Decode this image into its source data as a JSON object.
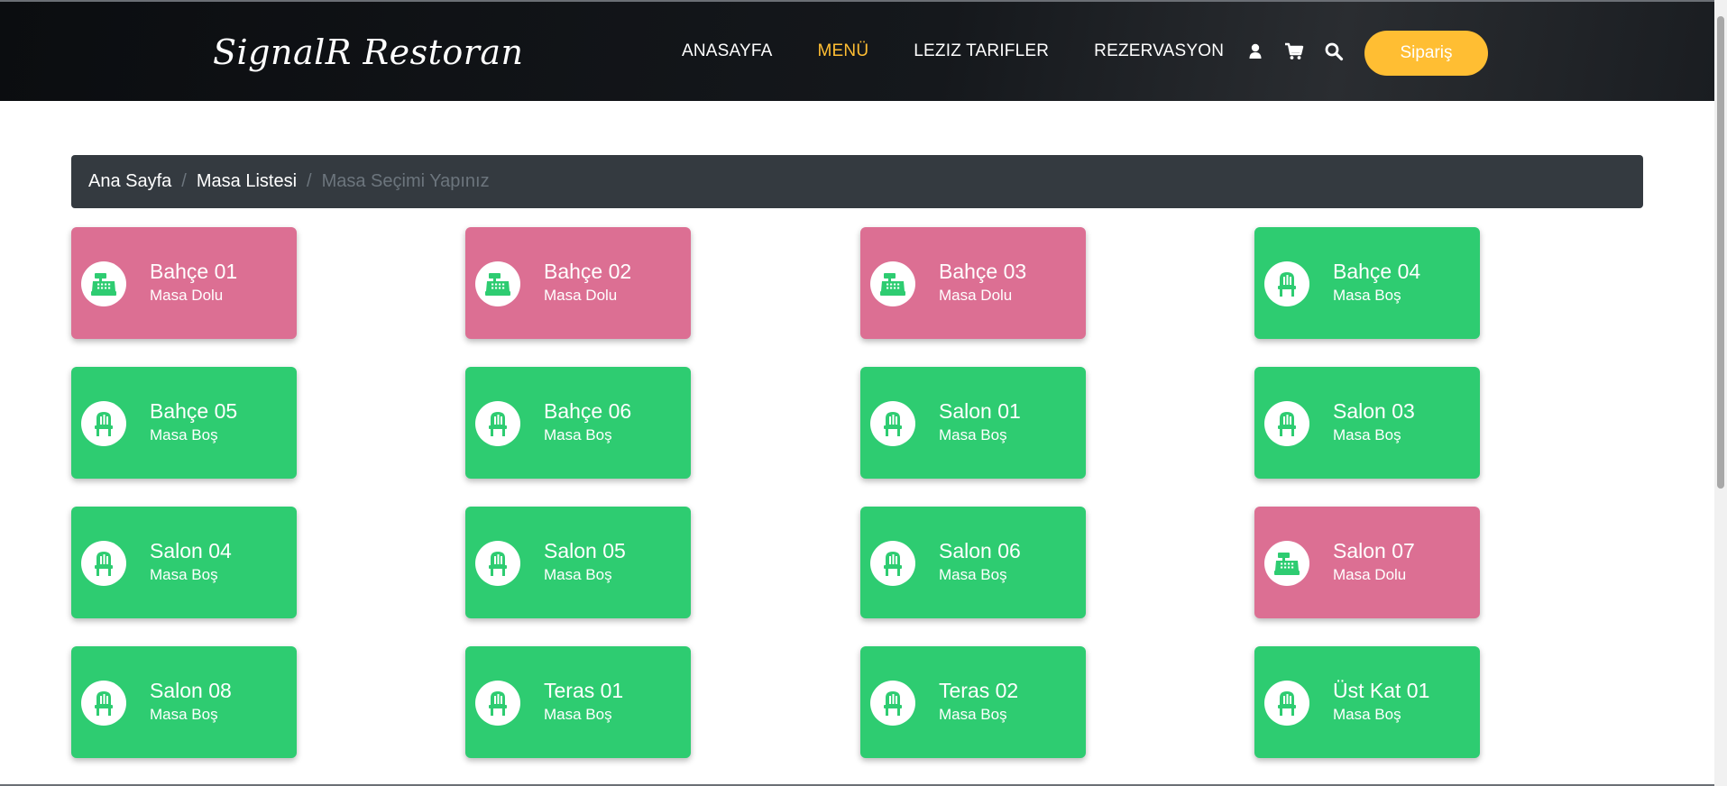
{
  "brand": "SignalR Restoran",
  "nav": [
    {
      "label": "ANASAYFA",
      "active": false
    },
    {
      "label": "MENÜ",
      "active": true
    },
    {
      "label": "LEZIZ TARIFLER",
      "active": false
    },
    {
      "label": "REZERVASYON",
      "active": false
    }
  ],
  "nav_icons": [
    "user-icon",
    "cart-icon",
    "search-icon"
  ],
  "order_button": "Sipariş",
  "breadcrumb": {
    "items": [
      "Ana Sayfa",
      "Masa Listesi"
    ],
    "separator": "/",
    "current": "Masa Seçimi Yapınız"
  },
  "colors": {
    "accent": "#ffbe33",
    "occupied": "#dc6f93",
    "available": "#2ecc71",
    "breadcrumb_bg": "#343a40"
  },
  "tables": [
    {
      "name": "Bahçe 01",
      "status": "Masa Dolu",
      "icon": "cash-register-icon"
    },
    {
      "name": "Bahçe 02",
      "status": "Masa Dolu",
      "icon": "cash-register-icon"
    },
    {
      "name": "Bahçe 03",
      "status": "Masa Dolu",
      "icon": "cash-register-icon"
    },
    {
      "name": "Bahçe 04",
      "status": "Masa Boş",
      "icon": "chair-icon"
    },
    {
      "name": "Bahçe 05",
      "status": "Masa Boş",
      "icon": "chair-icon"
    },
    {
      "name": "Bahçe 06",
      "status": "Masa Boş",
      "icon": "chair-icon"
    },
    {
      "name": "Salon 01",
      "status": "Masa Boş",
      "icon": "chair-icon"
    },
    {
      "name": "Salon 03",
      "status": "Masa Boş",
      "icon": "chair-icon"
    },
    {
      "name": "Salon 04",
      "status": "Masa Boş",
      "icon": "chair-icon"
    },
    {
      "name": "Salon 05",
      "status": "Masa Boş",
      "icon": "chair-icon"
    },
    {
      "name": "Salon 06",
      "status": "Masa Boş",
      "icon": "chair-icon"
    },
    {
      "name": "Salon 07",
      "status": "Masa Dolu",
      "icon": "cash-register-icon"
    },
    {
      "name": "Salon 08",
      "status": "Masa Boş",
      "icon": "chair-icon"
    },
    {
      "name": "Teras 01",
      "status": "Masa Boş",
      "icon": "chair-icon"
    },
    {
      "name": "Teras 02",
      "status": "Masa Boş",
      "icon": "chair-icon"
    },
    {
      "name": "Üst Kat 01",
      "status": "Masa Boş",
      "icon": "chair-icon"
    }
  ]
}
